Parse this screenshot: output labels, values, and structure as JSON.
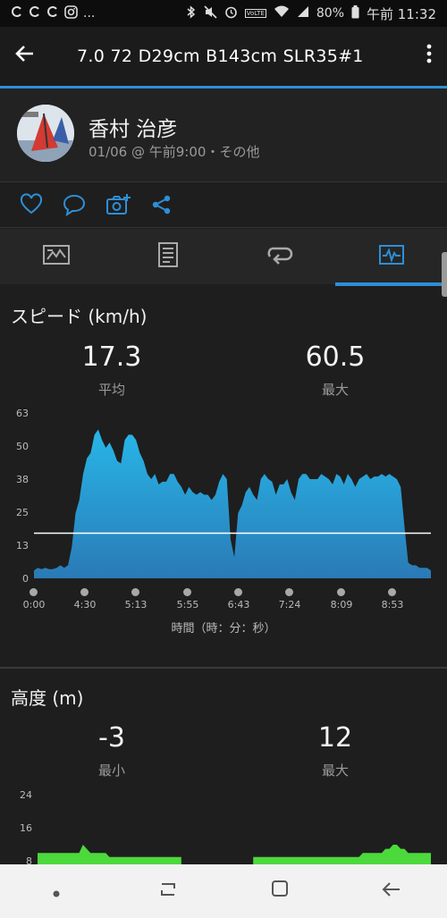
{
  "status_bar": {
    "left_icons": [
      "notification-icon",
      "notification-icon",
      "notification-icon",
      "instagram-icon",
      "more-icon"
    ],
    "more_text": "...",
    "battery": "80%",
    "time": "午前 11:32",
    "volte": "VoLTE"
  },
  "app_bar": {
    "title": "7.0  72   D29cm  B143cm SLR35#1",
    "back_icon": "arrow-left-icon",
    "menu_icon": "more-vert-icon"
  },
  "profile": {
    "name": "香村 治彦",
    "meta": "01/06 @ 午前9:00・その他"
  },
  "actions": [
    "heart-icon",
    "comment-icon",
    "add-photo-icon",
    "share-icon"
  ],
  "tabs": [
    {
      "icon": "overview-icon"
    },
    {
      "icon": "details-icon"
    },
    {
      "icon": "laps-icon"
    },
    {
      "icon": "charts-icon",
      "active": true
    }
  ],
  "speed": {
    "title": "スピード (km/h)",
    "avg_value": "17.3",
    "avg_label": "平均",
    "max_value": "60.5",
    "max_label": "最大"
  },
  "altitude": {
    "title": "高度 (m)",
    "min_value": "-3",
    "min_label": "最小",
    "max_value": "12",
    "max_label": "最大"
  },
  "colors": {
    "accent": "#2e8fd6",
    "speed_fill_top": "#28b6e8",
    "speed_fill_bottom": "#2a7ab6",
    "altitude_fill": "#4cd93c"
  },
  "chart_data": [
    {
      "type": "area",
      "title": "スピード (km/h)",
      "xlabel": "時間（時：分：秒）",
      "ylabel": "",
      "x_tick_labels": [
        "0:00",
        "4:30",
        "5:13",
        "5:55",
        "6:43",
        "7:24",
        "8:09",
        "8:53"
      ],
      "y_tick_labels": [
        "63",
        "50",
        "38",
        "25",
        "13",
        "0"
      ],
      "ylim": [
        0,
        63
      ],
      "average_line": 17.3,
      "grid": false,
      "series": [
        {
          "values": [
            3,
            4,
            3.5,
            4,
            3.5,
            3.5,
            4,
            5,
            4,
            5,
            12,
            25,
            30,
            40,
            46,
            48,
            55,
            57,
            53,
            50,
            52,
            49,
            45,
            44,
            53,
            55,
            55,
            53,
            48,
            45,
            40,
            38,
            40,
            36,
            37,
            37,
            40,
            40,
            37,
            35,
            32,
            35,
            33,
            32,
            33,
            32,
            32,
            30,
            32,
            37,
            40,
            38,
            15,
            8,
            25,
            28,
            33,
            35,
            32,
            30,
            38,
            40,
            38,
            37,
            32,
            36,
            36,
            38,
            33,
            30,
            38,
            40,
            40,
            38,
            38,
            38,
            40,
            39,
            38,
            36,
            40,
            39,
            36,
            40,
            38,
            35,
            38,
            39,
            40,
            38,
            39,
            39,
            40,
            39,
            40,
            39,
            38,
            35,
            20,
            6,
            5,
            5,
            4,
            4,
            4,
            3
          ]
        }
      ]
    },
    {
      "type": "area",
      "title": "高度 (m)",
      "y_tick_labels": [
        "24",
        "16",
        "8"
      ],
      "ylim": [
        0,
        24
      ],
      "grid": false,
      "series": [
        {
          "values": [
            10,
            10,
            10,
            10,
            10,
            10,
            10,
            10,
            10,
            10,
            10,
            10,
            12,
            11,
            10,
            10,
            10,
            10,
            10,
            9,
            9,
            9,
            9,
            9,
            9,
            9,
            9,
            9,
            9,
            9,
            9,
            9,
            9,
            9,
            9,
            9,
            9,
            9,
            9,
            null,
            null,
            null,
            null,
            null,
            null,
            null,
            null,
            null,
            null,
            null,
            null,
            null,
            null,
            null,
            null,
            null,
            null,
            9,
            9,
            9,
            9,
            9,
            9,
            9,
            9,
            9,
            9,
            9,
            9,
            9,
            9,
            9,
            9,
            9,
            9,
            9,
            9,
            9,
            9,
            9,
            9,
            9,
            9,
            9,
            9,
            9,
            10,
            10,
            10,
            10,
            10,
            10,
            11,
            11,
            12,
            12,
            11,
            11,
            10,
            10,
            10,
            10,
            10,
            10,
            10
          ]
        }
      ]
    }
  ]
}
